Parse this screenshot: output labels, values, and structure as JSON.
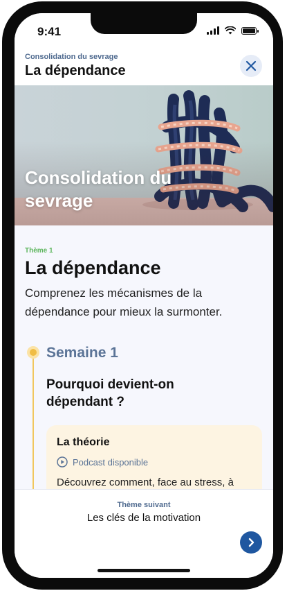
{
  "status_bar": {
    "time": "9:41"
  },
  "header": {
    "kicker": "Consolidation du sevrage",
    "title": "La dépendance"
  },
  "hero": {
    "title": "Consolidation du sevrage"
  },
  "theme": {
    "kicker": "Thème 1",
    "title": "La dépendance",
    "description": "Comprenez les mécanismes de la dépendance pour mieux la surmonter."
  },
  "week": {
    "label": "Semaine 1",
    "question": "Pourquoi devient-on dépendant ?",
    "card": {
      "title": "La théorie",
      "podcast_label": "Podcast disponible",
      "text": "Découvrez comment, face au stress, à"
    }
  },
  "footer": {
    "next_kicker": "Thème suivant",
    "next_title": "Les clés de la motivation"
  },
  "colors": {
    "accent_blue": "#1f57a0",
    "muted_blue": "#5b7497",
    "timeline_yellow": "#f0bd45",
    "theme_green": "#5cb55c",
    "card_bg": "#fdf4e2"
  },
  "icons": {
    "close": "close-icon",
    "podcast": "play-circle-icon",
    "next": "chevron-right-icon"
  }
}
